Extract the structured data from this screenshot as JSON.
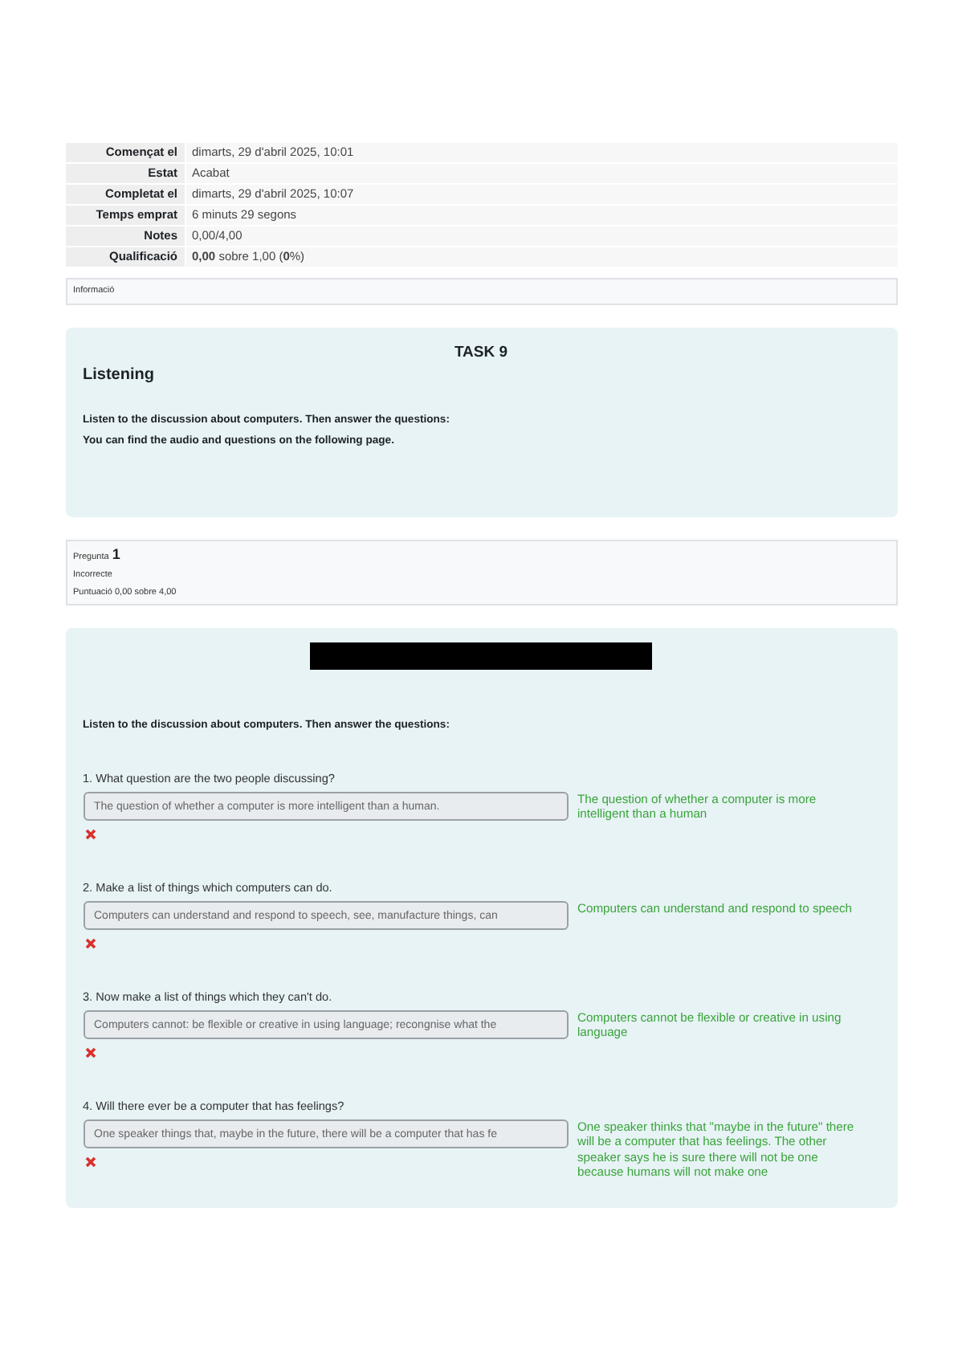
{
  "summary": [
    {
      "label": "Començat el",
      "value": "dimarts, 29 d'abril 2025, 10:01"
    },
    {
      "label": "Estat",
      "value": "Acabat"
    },
    {
      "label": "Completat el",
      "value": "dimarts, 29 d'abril 2025, 10:07"
    },
    {
      "label": "Temps emprat",
      "value": "6 minuts 29 segons"
    },
    {
      "label": "Notes",
      "value": "0,00/4,00"
    },
    {
      "label": "Qualificació",
      "value": "**0,00** sobre 1,00 (**0**%)"
    }
  ],
  "info_box": {
    "label": "Informació"
  },
  "task": {
    "heading": "TASK 9",
    "title": "Listening",
    "instruction": "Listen to the discussion about computers. Then answer the questions:",
    "note": "You can find the audio and questions on the following page."
  },
  "question_info": {
    "label": "Pregunta",
    "number": "1",
    "status": "Incorrecte",
    "score": "Puntuació 0,00 sobre 4,00"
  },
  "question": {
    "redacted": true,
    "instruction": "Listen to the discussion about computers. Then answer the questions:",
    "items": [
      {
        "prompt": "1. What question are the two people discussing?",
        "answer": "The question of whether a computer is more intelligent than a human.",
        "correct": false,
        "feedback": "The question of whether a computer is more intelligent than a human"
      },
      {
        "prompt": "2. Make a list of things which computers can do.",
        "answer": "Computers can understand and respond to speech, see, manufacture things, can",
        "correct": false,
        "feedback": "Computers can understand and respond to speech"
      },
      {
        "prompt": "3. Now make a list of things which they can't do.",
        "answer": "Computers cannot: be flexible or creative in using language; recongnise what the",
        "correct": false,
        "feedback": "Computers cannot be flexible or creative in using language"
      },
      {
        "prompt": "4. Will there ever be a computer that has feelings?",
        "answer": "One speaker things that, maybe in the future, there will be a computer that has fe",
        "correct": false,
        "feedback": "One speaker thinks that \"maybe in the future\" there will be a computer that has feelings. The other speaker says he is sure there will not be one because humans will not make one"
      }
    ]
  }
}
